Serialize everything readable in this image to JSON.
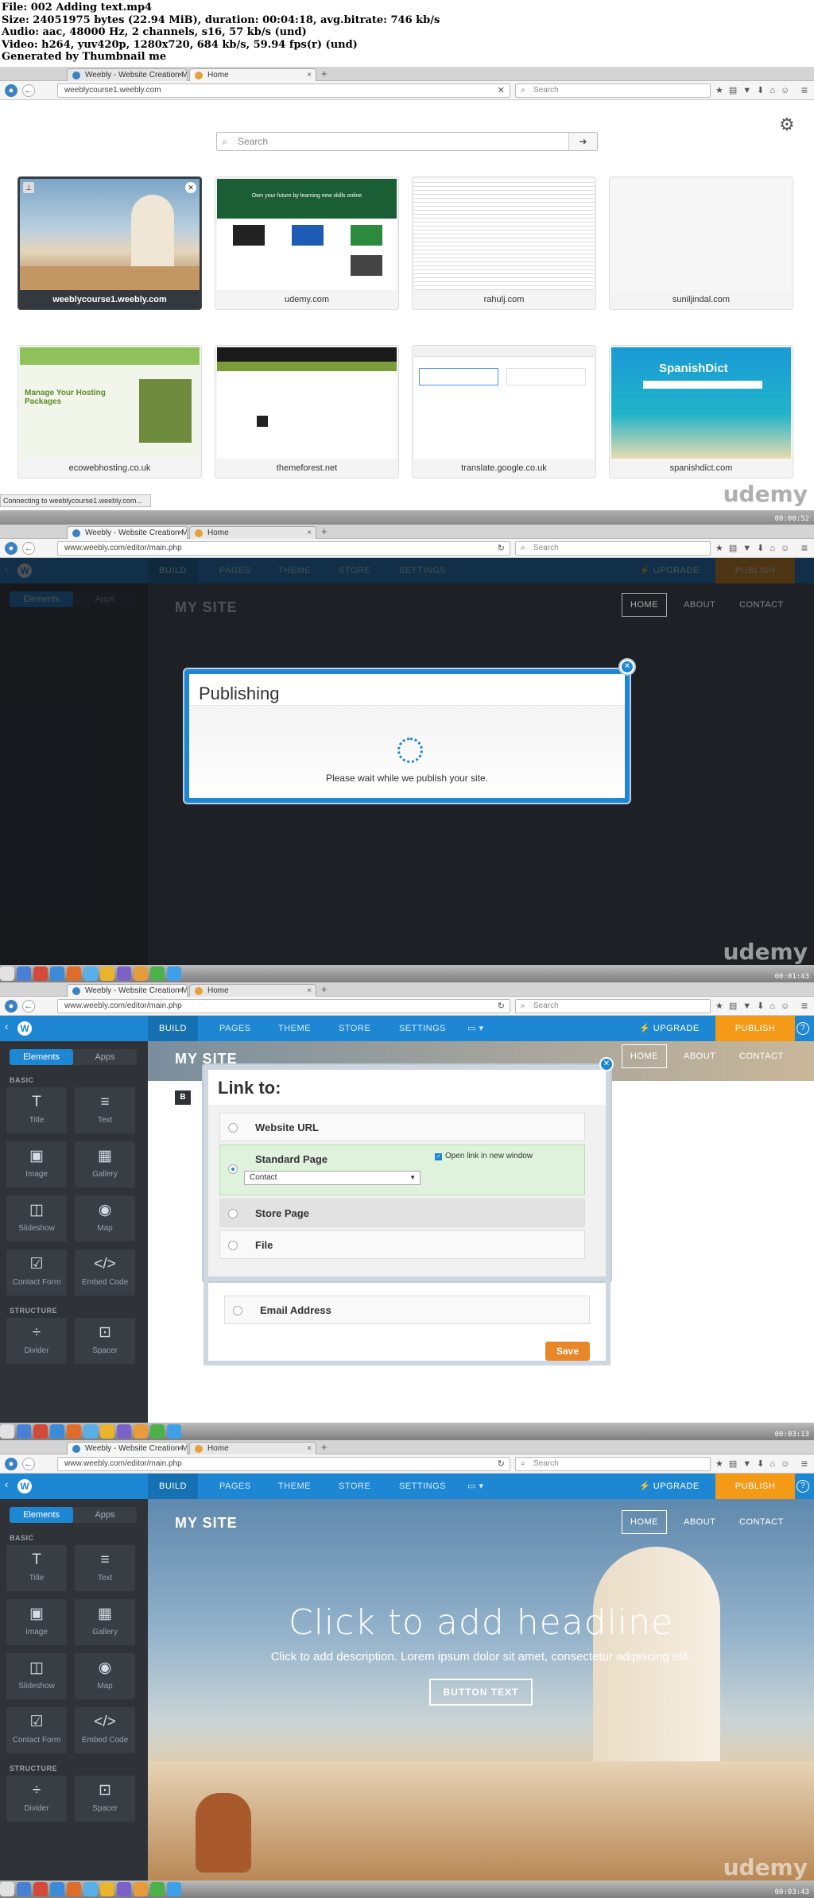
{
  "video_info": [
    "File: 002 Adding text.mp4",
    "Size: 24051975 bytes (22.94 MiB), duration: 00:04:18, avg.bitrate: 746 kb/s",
    "Audio: aac, 48000 Hz, 2 channels, s16, 57 kb/s (und)",
    "Video: h264, yuv420p, 1280x720, 684 kb/s, 59.94 fps(r) (und)",
    "Generated by Thumbnail me"
  ],
  "watermark": "udemy",
  "frames": [
    {
      "timestamp": "00:00:52",
      "tabs": [
        "Weebly - Website Creation M...",
        "Home"
      ],
      "url": "weeblycourse1.weebly.com",
      "search_placeholder": "Search",
      "ntp_search_placeholder": "Search",
      "status": "Connecting to weeblycourse1.weebly.com...",
      "tiles": [
        "weeblycourse1.weebly.com",
        "udemy.com",
        "rahulj.com",
        "suniljindal.com",
        "ecowebhosting.co.uk",
        "themeforest.net",
        "translate.google.co.uk",
        "spanishdict.com"
      ],
      "tile_texts": {
        "udemy_tag": "Own your future by learning new skills online",
        "eco_heading": "Manage Your Hosting Packages",
        "spanishdict_brand": "SpanishDict"
      }
    },
    {
      "timestamp": "00:01:43",
      "tabs": [
        "Weebly - Website Creation M...",
        "Home"
      ],
      "url": "www.weebly.com/editor/main.php",
      "search_placeholder": "Search",
      "modal_title": "Publishing",
      "modal_message": "Please wait while we publish your site."
    },
    {
      "timestamp": "00:03:13",
      "tabs": [
        "Weebly - Website Creation M...",
        "Home"
      ],
      "url": "www.weebly.com/editor/main.php",
      "search_placeholder": "Search",
      "modal_title": "Link to:",
      "options": [
        "Website URL",
        "Standard Page",
        "Store Page",
        "File",
        "Email Address"
      ],
      "checkbox_label": "Open link in new window",
      "page_select": "Contact",
      "save": "Save"
    },
    {
      "timestamp": "00:03:43",
      "tabs": [
        "Weebly - Website Creation M...",
        "Home"
      ],
      "url": "www.weebly.com/editor/main.php",
      "search_placeholder": "Search",
      "headline": "Click to add headline",
      "description": "Click to add description. Lorem ipsum dolor sit amet, consectetur adipiscing elit.",
      "button": "BUTTON TEXT"
    }
  ],
  "editor": {
    "top_nav": [
      "BUILD",
      "PAGES",
      "THEME",
      "STORE",
      "SETTINGS"
    ],
    "upgrade": "UPGRADE",
    "publish": "PUBLISH",
    "sidebar_tabs": [
      "Elements",
      "Apps"
    ],
    "basic_label": "BASIC",
    "structure_label": "STRUCTURE",
    "elements": [
      "Title",
      "Text",
      "Image",
      "Gallery",
      "Slideshow",
      "Map",
      "Contact Form",
      "Embed Code",
      "Divider",
      "Spacer"
    ],
    "site_title": "MY SITE",
    "site_nav": [
      "HOME",
      "ABOUT",
      "CONTACT"
    ]
  }
}
